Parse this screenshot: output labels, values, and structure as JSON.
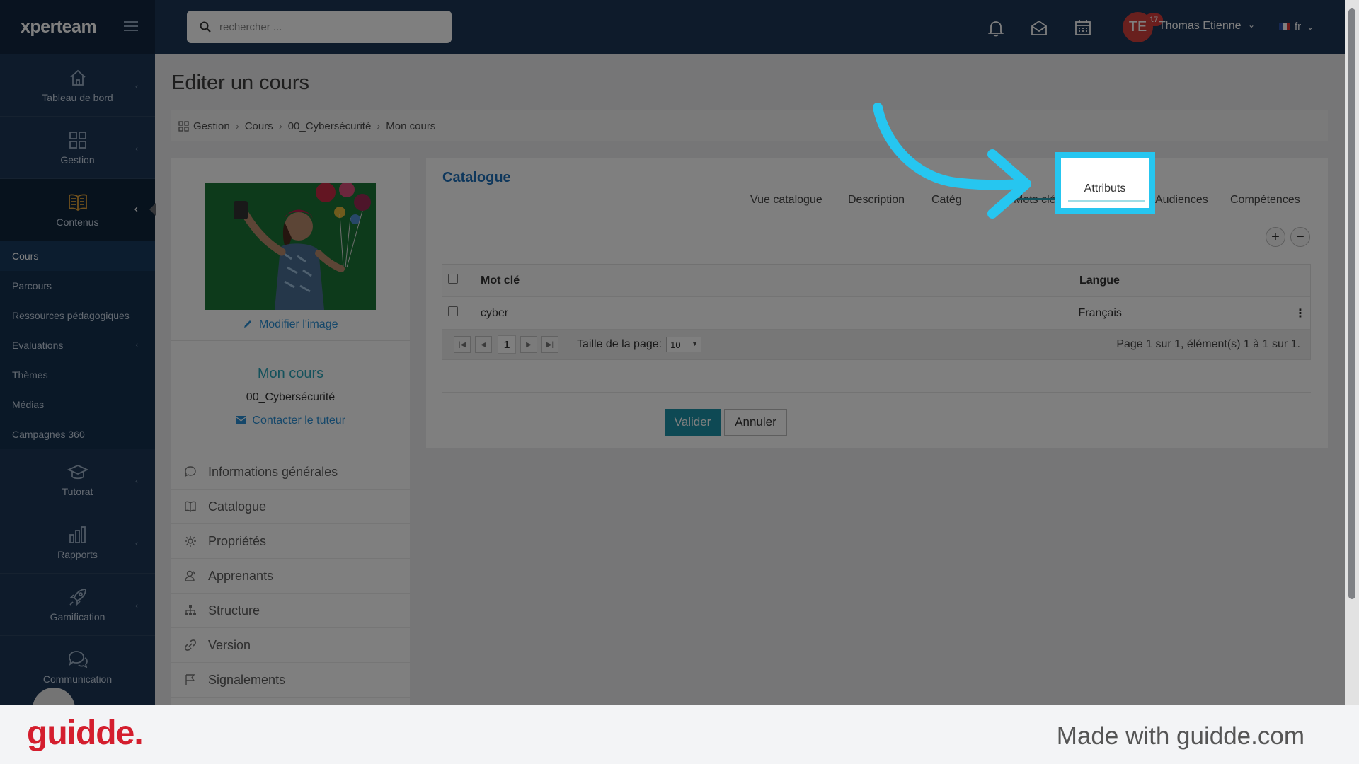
{
  "brand": {
    "name": "xperteam"
  },
  "sidebar": {
    "nav_top": [
      {
        "label": "Tableau de bord",
        "icon": "home-icon"
      },
      {
        "label": "Gestion",
        "icon": "grid-icon"
      },
      {
        "label": "Contenus",
        "icon": "book-icon"
      }
    ],
    "sub_items": [
      "Cours",
      "Parcours",
      "Ressources pédagogiques",
      "Evaluations",
      "Thèmes",
      "Médias",
      "Campagnes 360"
    ],
    "nav_bottom": [
      {
        "label": "Tutorat",
        "icon": "graduation-cap-icon"
      },
      {
        "label": "Rapports",
        "icon": "bar-chart-icon"
      },
      {
        "label": "Gamification",
        "icon": "rocket-icon"
      },
      {
        "label": "Communication",
        "icon": "chat-icon"
      }
    ]
  },
  "topbar": {
    "search_placeholder": "rechercher ...",
    "notification_count": "17",
    "user_initials": "TE",
    "user_name": "Thomas Etienne",
    "language": "fr"
  },
  "page": {
    "title": "Editer un cours",
    "breadcrumb": [
      "Gestion",
      "Cours",
      "00_Cybersécurité",
      "Mon cours"
    ]
  },
  "course_card": {
    "edit_image": "Modifier l'image",
    "name": "Mon cours",
    "parent": "00_Cybersécurité",
    "contact": "Contacter le tuteur",
    "menu": [
      {
        "label": "Informations générales",
        "icon": "comment-icon"
      },
      {
        "label": "Catalogue",
        "icon": "book-icon"
      },
      {
        "label": "Propriétés",
        "icon": "gear-icon"
      },
      {
        "label": "Apprenants",
        "icon": "users-icon"
      },
      {
        "label": "Structure",
        "icon": "sitemap-icon"
      },
      {
        "label": "Version",
        "icon": "link-icon"
      },
      {
        "label": "Signalements",
        "icon": "flag-icon"
      }
    ]
  },
  "panel": {
    "title": "Catalogue",
    "tabs": [
      "Vue catalogue",
      "Description",
      "Catég",
      "Mots clés",
      "Attributs",
      "Audiences",
      "Compétences"
    ],
    "highlighted_tab": "Attributs",
    "table": {
      "columns": [
        "Mot clé",
        "Langue"
      ],
      "rows": [
        {
          "keyword": "cyber",
          "language": "Français"
        }
      ]
    },
    "pager": {
      "current_page": "1",
      "page_size_label": "Taille de la page:",
      "page_size": "10",
      "info": "Page 1 sur 1, élément(s) 1 à 1 sur 1."
    },
    "btn_valider": "Valider",
    "btn_annuler": "Annuler"
  },
  "footer": {
    "logo": "guidde.",
    "made_with": "Made with guidde.com"
  },
  "colors": {
    "sidebar_bg": "#1c3656",
    "accent_teal": "#2aa4b8",
    "link_blue": "#2a8fd4",
    "highlight_cyan": "#26c6f0",
    "guidde_red": "#d41e2e"
  }
}
